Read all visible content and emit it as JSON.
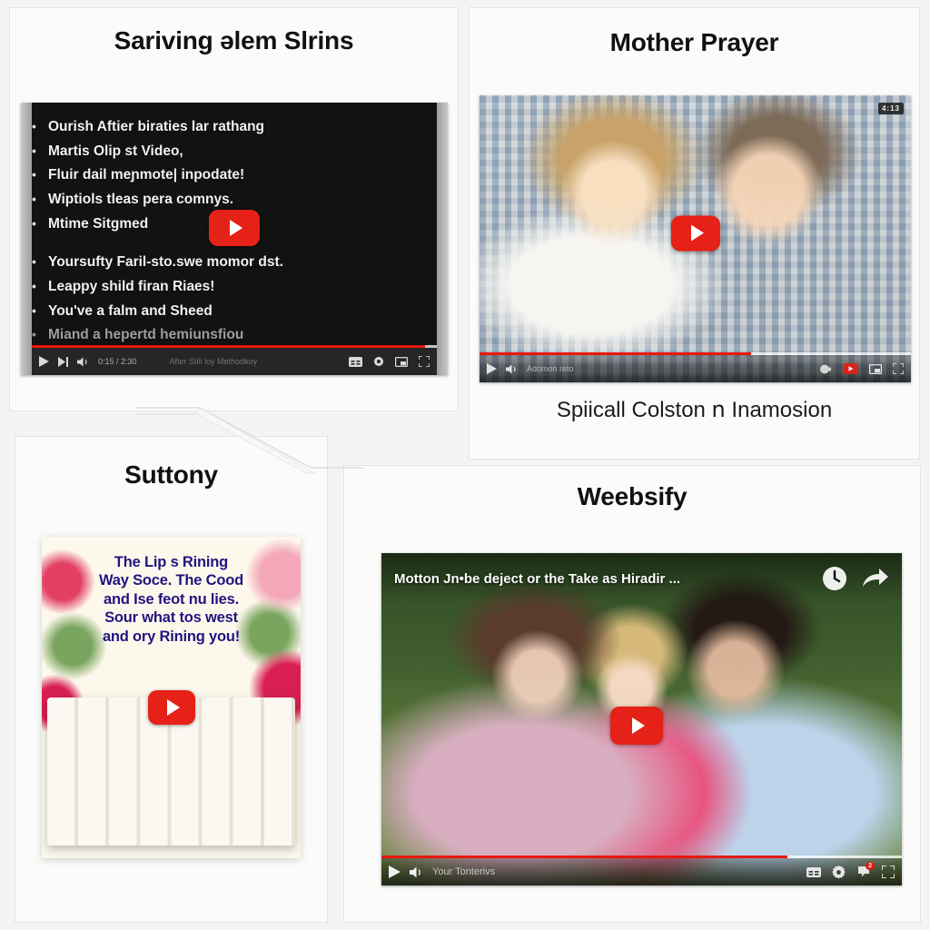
{
  "page": {
    "background_color": "#f4f4f2",
    "card_background": "#fbfbfa",
    "accent_red": "#e62117",
    "quote_text_color": "#22147d"
  },
  "cards": [
    {
      "id": "card-slide-video",
      "title": "Sariving ǝlem Slrins",
      "player": {
        "type": "slide",
        "bullets_top": [
          "Ourish Aftier biraties lar rathang",
          "Martis Olip st Video,",
          "Fluir dail meɲmote| inpodate!",
          "Wiptiols tleas pera comnys.",
          "Mtime Sitgmed"
        ],
        "bullets_bottom": [
          "Yoursufty Faril-sto.swe momor dst.",
          "Leappy shild firan Riaes!",
          "You've a falm and Sheed",
          "Miand a hepertd hemiunsfiou"
        ],
        "controls": {
          "play_icon": "play-icon",
          "next_icon": "next-track-icon",
          "volume_icon": "volume-icon",
          "time": "0:15 / 2:30",
          "subtitle": "After Still loy Methodkoy",
          "right_icons": [
            "captions-icon",
            "settings-icon",
            "miniplayer-icon",
            "fullscreen-icon"
          ],
          "progress_percent": 97
        }
      }
    },
    {
      "id": "card-mother-prayer",
      "title": "Mother Prayer",
      "caption": "Spiicall Colston ո Inamosion",
      "player": {
        "type": "photo-couple",
        "time_badge": "4:13",
        "controls": {
          "play_icon": "play-icon",
          "volume_icon": "volume-icon",
          "time": "Adomon reto",
          "right_icons": [
            "captions-icon",
            "youtube-icon",
            "miniplayer-icon",
            "fullscreen-icon"
          ],
          "progress_percent": 63
        }
      }
    },
    {
      "id": "card-suttony",
      "title": "Suttony",
      "player": {
        "type": "photo-dessert",
        "quote_lines": [
          "The Lip s Rining",
          "Way Soce. The Cood",
          "and Ise feot nu lies.",
          "Sour what tos west",
          "and ory Rining you!"
        ]
      }
    },
    {
      "id": "card-weebsify",
      "title": "Weebsify",
      "player": {
        "type": "photo-park",
        "overlay_title": "Motton Jn•be deject or the Take as Hiradir ...",
        "overlay_icons": [
          "clock-icon",
          "share-icon"
        ],
        "controls": {
          "play_icon": "play-icon",
          "volume_icon": "volume-icon",
          "label": "Your Tonterivs",
          "right_icons": [
            "captions-icon",
            "settings-icon",
            "notifications-icon",
            "fullscreen-icon"
          ],
          "notification_count": "2",
          "progress_percent": 78
        }
      }
    }
  ]
}
